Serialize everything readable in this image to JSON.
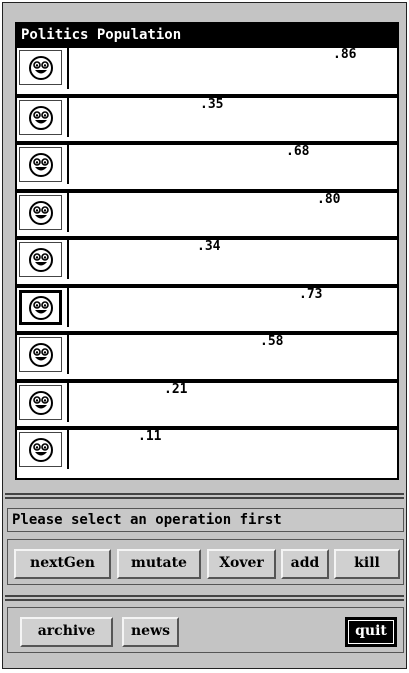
{
  "population": {
    "title": "Politics Population",
    "rows": [
      {
        "fitness_label": ".86",
        "fitness": 0.86
      },
      {
        "fitness_label": ".35",
        "fitness": 0.35
      },
      {
        "fitness_label": ".68",
        "fitness": 0.68
      },
      {
        "fitness_label": ".80",
        "fitness": 0.8
      },
      {
        "fitness_label": ".34",
        "fitness": 0.34
      },
      {
        "fitness_label": ".73",
        "fitness": 0.73
      },
      {
        "fitness_label": ".58",
        "fitness": 0.58
      },
      {
        "fitness_label": ".21",
        "fitness": 0.21
      },
      {
        "fitness_label": ".11",
        "fitness": 0.11
      }
    ],
    "row_icon": "smiley-face-icon",
    "selected_row": 5
  },
  "status": {
    "message": "Please select an operation first"
  },
  "operations": {
    "next_gen": "nextGen",
    "mutate": "mutate",
    "xover": "Xover",
    "add": "add",
    "kill": "kill"
  },
  "footer": {
    "archive": "archive",
    "news": "news",
    "quit": "quit"
  }
}
